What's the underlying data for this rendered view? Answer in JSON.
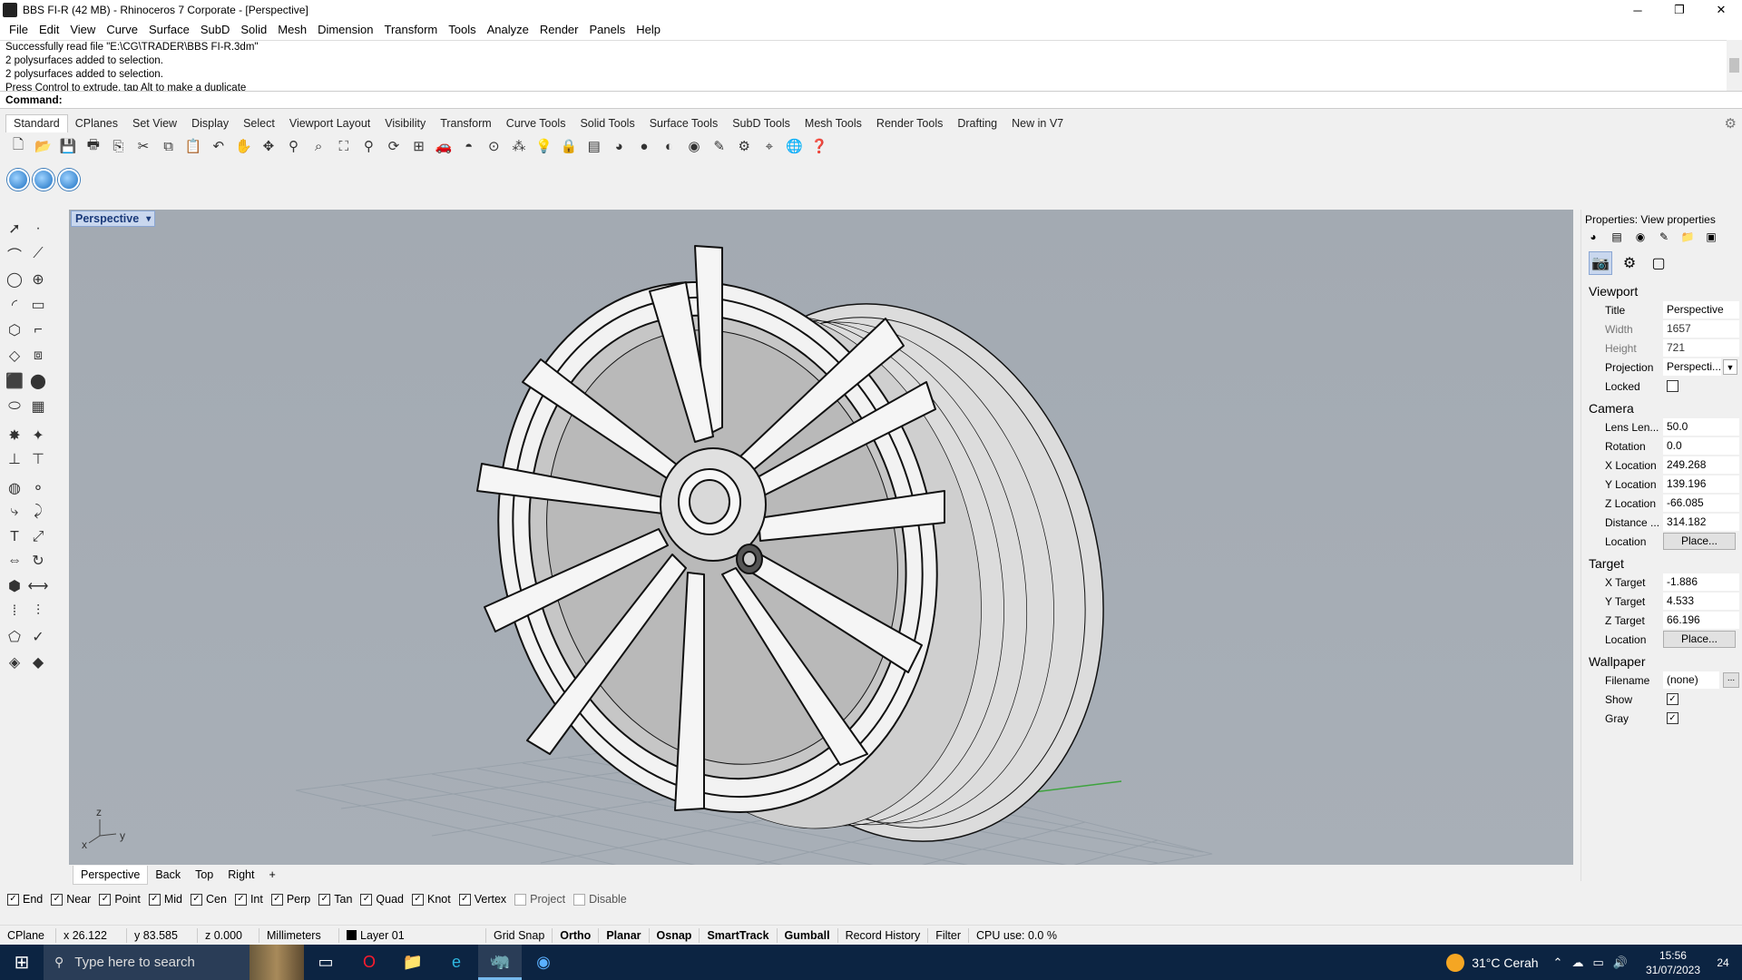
{
  "window": {
    "title": "BBS FI-R (42 MB) - Rhinoceros 7 Corporate - [Perspective]",
    "minimize": "─",
    "maximize": "❐",
    "close": "✕"
  },
  "menu": [
    "File",
    "Edit",
    "View",
    "Curve",
    "Surface",
    "SubD",
    "Solid",
    "Mesh",
    "Dimension",
    "Transform",
    "Tools",
    "Analyze",
    "Render",
    "Panels",
    "Help"
  ],
  "command": {
    "history": [
      "Successfully read file \"E:\\CG\\TRADER\\BBS FI-R.3dm\"",
      "2 polysurfaces added to selection.",
      "2 polysurfaces added to selection.",
      "Press Control to extrude, tap Alt to make a duplicate"
    ],
    "prompt": "Command:",
    "value": ""
  },
  "toolbar_tabs": [
    "Standard",
    "CPlanes",
    "Set View",
    "Display",
    "Select",
    "Viewport Layout",
    "Visibility",
    "Transform",
    "Curve Tools",
    "Solid Tools",
    "Surface Tools",
    "SubD Tools",
    "Mesh Tools",
    "Render Tools",
    "Drafting",
    "New in V7"
  ],
  "active_tab": "Standard",
  "viewport": {
    "label": "Perspective",
    "arrow": "▾",
    "axis_x": "x",
    "axis_y": "y",
    "axis_z": "z",
    "tabs": [
      "Perspective",
      "Back",
      "Top",
      "Right"
    ],
    "add_tab": "+"
  },
  "osnaps": [
    {
      "label": "End",
      "checked": true
    },
    {
      "label": "Near",
      "checked": true
    },
    {
      "label": "Point",
      "checked": true
    },
    {
      "label": "Mid",
      "checked": true
    },
    {
      "label": "Cen",
      "checked": true
    },
    {
      "label": "Int",
      "checked": true
    },
    {
      "label": "Perp",
      "checked": true
    },
    {
      "label": "Tan",
      "checked": true
    },
    {
      "label": "Quad",
      "checked": true
    },
    {
      "label": "Knot",
      "checked": true
    },
    {
      "label": "Vertex",
      "checked": true
    },
    {
      "label": "Project",
      "checked": false
    },
    {
      "label": "Disable",
      "checked": false
    }
  ],
  "status": {
    "cplane": "CPlane",
    "x": "x 26.122",
    "y": "y 83.585",
    "z": "z 0.000",
    "units": "Millimeters",
    "layer": "Layer 01",
    "grid_snap": "Grid Snap",
    "ortho": "Ortho",
    "planar": "Planar",
    "osnap": "Osnap",
    "smarttrack": "SmartTrack",
    "gumball": "Gumball",
    "record_history": "Record History",
    "filter": "Filter",
    "cpu": "CPU use: 0.0 %"
  },
  "properties": {
    "header": "Properties: View properties",
    "viewport_section": "Viewport",
    "title_label": "Title",
    "title_value": "Perspective",
    "width_label": "Width",
    "width_value": "1657",
    "height_label": "Height",
    "height_value": "721",
    "projection_label": "Projection",
    "projection_value": "Perspecti...",
    "locked_label": "Locked",
    "camera_section": "Camera",
    "lens_label": "Lens Len...",
    "lens_value": "50.0",
    "rotation_label": "Rotation",
    "rotation_value": "0.0",
    "xloc_label": "X Location",
    "xloc_value": "249.268",
    "yloc_label": "Y Location",
    "yloc_value": "139.196",
    "zloc_label": "Z Location",
    "zloc_value": "-66.085",
    "distance_label": "Distance ...",
    "distance_value": "314.182",
    "location_label": "Location",
    "place_button": "Place...",
    "target_section": "Target",
    "xtarget_label": "X Target",
    "xtarget_value": "-1.886",
    "ytarget_label": "Y Target",
    "ytarget_value": "4.533",
    "ztarget_label": "Z Target",
    "ztarget_value": "66.196",
    "target_location_label": "Location",
    "target_place_button": "Place...",
    "wallpaper_section": "Wallpaper",
    "filename_label": "Filename",
    "filename_value": "(none)",
    "browse_button": "...",
    "show_label": "Show",
    "show_checked": true,
    "gray_label": "Gray",
    "gray_checked": true
  },
  "taskbar": {
    "search_placeholder": "Type here to search",
    "weather": "31°C  Cerah",
    "time": "15:56",
    "date": "31/07/2023",
    "notifications": "24"
  }
}
